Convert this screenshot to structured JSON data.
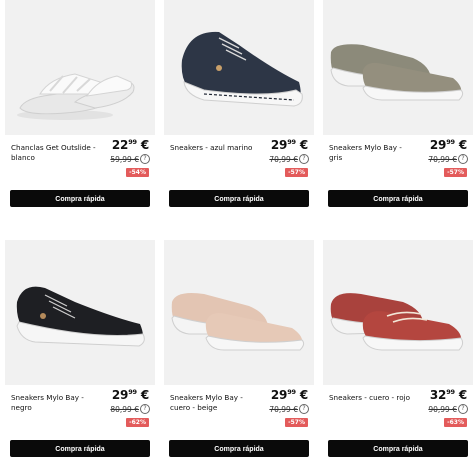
{
  "products": [
    {
      "name": "Chanclas Get Outslide - blanco",
      "price_int": "22",
      "price_dec": "99",
      "currency": "€",
      "old_price": "59,99 €",
      "discount": "-54%",
      "cta": "Compra rápida",
      "info_icon": "info-icon"
    },
    {
      "name": "Sneakers - azul marino",
      "price_int": "29",
      "price_dec": "99",
      "currency": "€",
      "old_price": "70,99 €",
      "discount": "-57%",
      "cta": "Compra rápida",
      "info_icon": "info-icon"
    },
    {
      "name": "Sneakers Mylo Bay - gris",
      "price_int": "29",
      "price_dec": "99",
      "currency": "€",
      "old_price": "70,99 €",
      "discount": "-57%",
      "cta": "Compra rápida",
      "info_icon": "info-icon"
    },
    {
      "name": "Sneakers Mylo Bay - negro",
      "price_int": "29",
      "price_dec": "99",
      "currency": "€",
      "old_price": "80,99 €",
      "discount": "-62%",
      "cta": "Compra rápida",
      "info_icon": "info-icon"
    },
    {
      "name": "Sneakers Mylo Bay - cuero - beige",
      "price_int": "29",
      "price_dec": "99",
      "currency": "€",
      "old_price": "70,99 €",
      "discount": "-57%",
      "cta": "Compra rápida",
      "info_icon": "info-icon"
    },
    {
      "name": "Sneakers - cuero - rojo",
      "price_int": "32",
      "price_dec": "99",
      "currency": "€",
      "old_price": "90,99 €",
      "discount": "-63%",
      "cta": "Compra rápida",
      "info_icon": "info-icon"
    }
  ],
  "colors": {
    "badge": "#e35b5b",
    "button": "#0a0a0a",
    "image_bg": "#f1f1f1"
  }
}
